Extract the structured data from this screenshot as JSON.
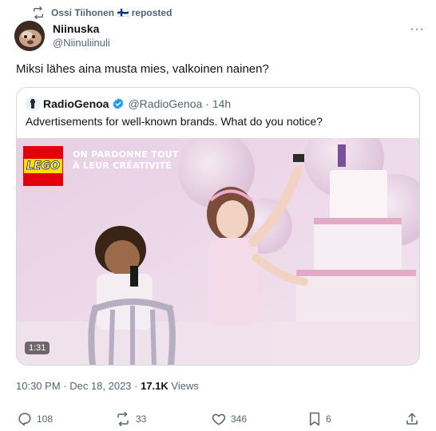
{
  "repost": {
    "text": "Ossi Tiihonen 🇫🇮 reposted"
  },
  "tweet": {
    "author_name": "Niinuska",
    "author_handle": "@Niinuliinuli",
    "text": "Miksi lähes aina musta mies, valkoinen nainen?",
    "timestamp": "10:30 PM · Dec 18, 2023 · ",
    "views_count": "17.1K",
    "views_label": " Views"
  },
  "quote": {
    "author_name": "RadioGenoa",
    "author_handle": "@RadioGenoa",
    "time": "· 14h",
    "text": "Advertisements for well-known brands. What do you notice?",
    "media": {
      "logo_text": "LEGO",
      "slogan_line1": "ON PARDONNE TOUT",
      "slogan_line2": "À LEUR CRÉATIVITÉ",
      "duration": "1:31"
    }
  },
  "actions": {
    "replies": "108",
    "reposts": "33",
    "likes": "346",
    "bookmarks": "6"
  },
  "colors": {
    "text_primary": "#0f1419",
    "text_secondary": "#536471",
    "border": "#cfd9de",
    "verified": "#1d9bf0",
    "lego_red": "#e3000b",
    "lego_yellow": "#ffe000"
  }
}
